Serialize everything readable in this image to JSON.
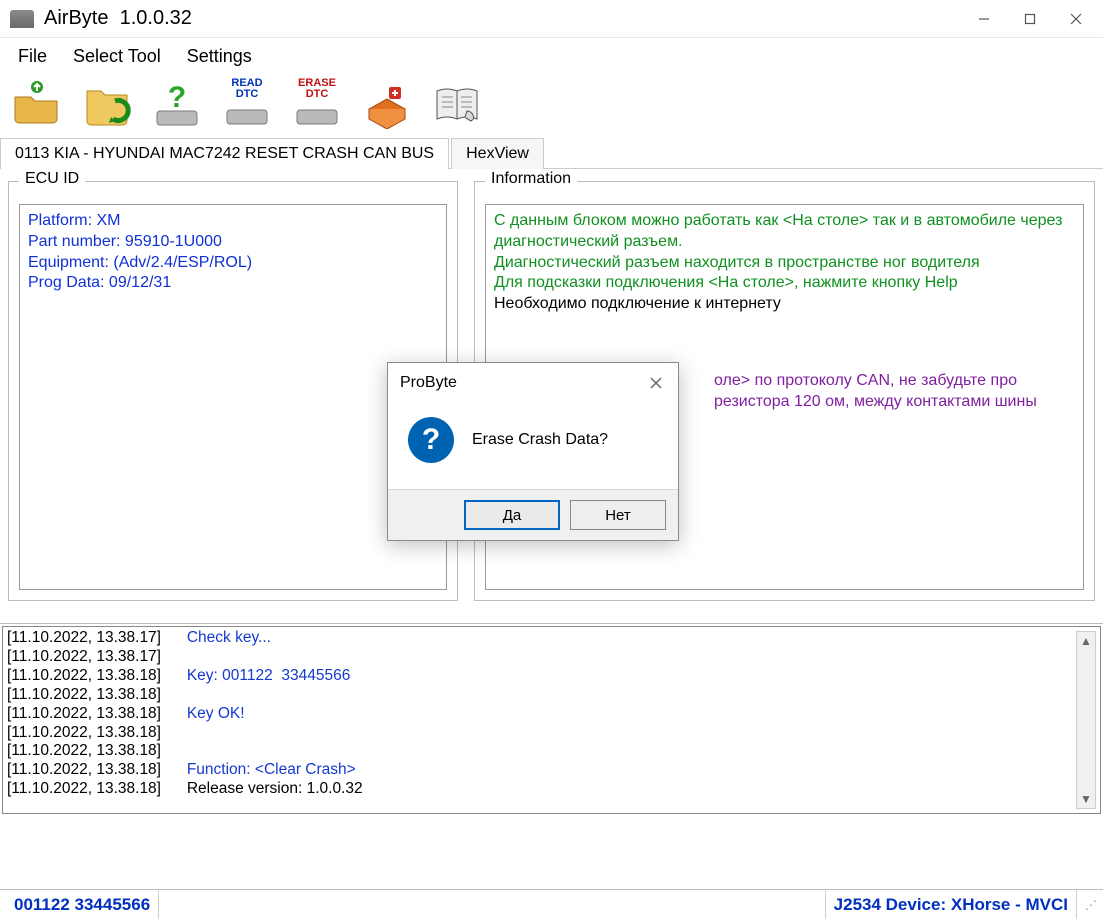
{
  "titlebar": {
    "app_name": "AirByte",
    "version": "1.0.0.32"
  },
  "menu": {
    "file": "File",
    "select_tool": "Select Tool",
    "settings": "Settings"
  },
  "toolbar": {
    "open": "open",
    "folder": "folder",
    "help": "help",
    "read_dtc_l1": "READ",
    "read_dtc_l2": "DTC",
    "erase_dtc_l1": "ERASE",
    "erase_dtc_l2": "DTC",
    "module": "module",
    "manual": "manual"
  },
  "tabs": {
    "vehicle": "0113 KIA - HYUNDAI MAC7242 RESET CRASH CAN BUS",
    "hexview": "HexView"
  },
  "ecu": {
    "legend": "ECU ID",
    "line1": "Platform: XM",
    "line2": "Part number: 95910-1U000",
    "line3": "Equipment: (Adv/2.4/ESP/ROL)",
    "line4": "Prog Data: 09/12/31"
  },
  "info": {
    "legend": "Information",
    "g1": "С данным блоком можно работать как <На столе> так и в автомобиле через диагностический разъем.",
    "g2": "Диагностический разъем находится в пространстве ног водителя",
    "g3": "Для подсказки подключения <На столе>, нажмите кнопку Help",
    "b1": "Необходимо подключение к интернету",
    "v1": "оле> по протоколу CAN, не забудьте про",
    "v2": "резистора 120 ом, между контактами шины"
  },
  "log": [
    {
      "ts": "[11.10.2022, 13.38.17]",
      "txt": "Check key...",
      "cls": "blue"
    },
    {
      "ts": "[11.10.2022, 13.38.17]",
      "txt": "",
      "cls": "blue"
    },
    {
      "ts": "[11.10.2022, 13.38.18]",
      "txt": "Key: 001122  33445566",
      "cls": "blue"
    },
    {
      "ts": "[11.10.2022, 13.38.18]",
      "txt": "",
      "cls": "blue"
    },
    {
      "ts": "[11.10.2022, 13.38.18]",
      "txt": "Key OK!",
      "cls": "blue"
    },
    {
      "ts": "[11.10.2022, 13.38.18]",
      "txt": "",
      "cls": "blue"
    },
    {
      "ts": "[11.10.2022, 13.38.18]",
      "txt": "",
      "cls": "blue"
    },
    {
      "ts": "[11.10.2022, 13.38.18]",
      "txt": "Function: <Clear Crash>",
      "cls": "blue"
    },
    {
      "ts": "[11.10.2022, 13.38.18]",
      "txt": "Release version: 1.0.0.32",
      "cls": "blk"
    }
  ],
  "status": {
    "key": "001122  33445566",
    "device": "J2534 Device: XHorse - MVCI"
  },
  "modal": {
    "title": "ProByte",
    "question_mark": "?",
    "message": "Erase Crash Data?",
    "yes": "Да",
    "no": "Нет"
  }
}
